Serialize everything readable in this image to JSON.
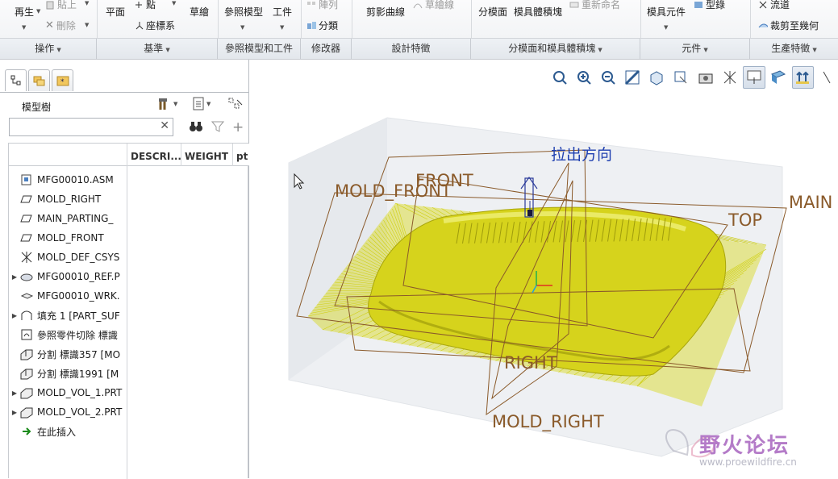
{
  "ribbon": {
    "buttons": {
      "regenerate": "再生",
      "paste": "貼上",
      "delete": "刪除",
      "plane": "平面",
      "point": "點",
      "coord_sys": "座標系",
      "sketch": "草繪",
      "ref_model": "參照模型",
      "workpiece": "工件",
      "pattern": "陣列",
      "classify": "分類",
      "trim_curve": "剪影曲線",
      "sketch_curve": "草繪線",
      "split_surface": "分模面",
      "mold_volume": "模具體積塊",
      "rename": "重新命名",
      "mold_component": "模具元件",
      "molding": "型錄",
      "runner": "流道",
      "trim_to_geometry": "裁剪至幾何"
    },
    "groups": [
      "操作",
      "基準",
      "參照模型和工件",
      "修改器",
      "設計特徵",
      "分模面和模具體積塊",
      "元件",
      "生產特徵"
    ]
  },
  "model_tree": {
    "title": "模型樹",
    "filter_placeholder": "",
    "columns": [
      "DESCRI...",
      "WEIGHT",
      "pt"
    ],
    "items": [
      {
        "label": "MFG00010.ASM",
        "icon": "assembly-icon",
        "expandable": false
      },
      {
        "label": "MOLD_RIGHT",
        "icon": "datum-plane-icon",
        "expandable": false
      },
      {
        "label": "MAIN_PARTING_",
        "icon": "datum-plane-icon",
        "expandable": false
      },
      {
        "label": "MOLD_FRONT",
        "icon": "datum-plane-icon",
        "expandable": false
      },
      {
        "label": "MOLD_DEF_CSYS",
        "icon": "csys-icon",
        "expandable": false
      },
      {
        "label": "MFG00010_REF.P",
        "icon": "ref-part-icon",
        "expandable": true
      },
      {
        "label": "MFG00010_WRK.",
        "icon": "workpiece-icon",
        "expandable": false
      },
      {
        "label": "填充 1 [PART_SUF",
        "icon": "fill-surface-icon",
        "expandable": true
      },
      {
        "label": "參照零件切除 標識",
        "icon": "ref-part-cutout-icon",
        "expandable": false
      },
      {
        "label": "分割 標識357 [MO",
        "icon": "split-icon",
        "expandable": false
      },
      {
        "label": "分割 標識1991 [M",
        "icon": "split-icon",
        "expandable": false
      },
      {
        "label": "MOLD_VOL_1.PRT",
        "icon": "mold-volume-icon",
        "expandable": true
      },
      {
        "label": "MOLD_VOL_2.PRT",
        "icon": "mold-volume-icon",
        "expandable": true
      },
      {
        "label": "在此插入",
        "icon": "insert-here-icon",
        "expandable": false
      }
    ]
  },
  "scene": {
    "labels": {
      "pull_direction": "拉出方向",
      "front": "FRONT",
      "mold_front": "MOLD_FRONT",
      "top": "TOP",
      "main": "MAIN",
      "right": "RIGHT",
      "mold_right": "MOLD_RIGHT"
    },
    "colors": {
      "part_yellow": "#d6d619",
      "datum_brown": "#8a5a2a",
      "pull_label_blue": "#2040b0"
    }
  },
  "watermark": {
    "text": "野火论坛",
    "url": "www.proewildfire.cn"
  }
}
